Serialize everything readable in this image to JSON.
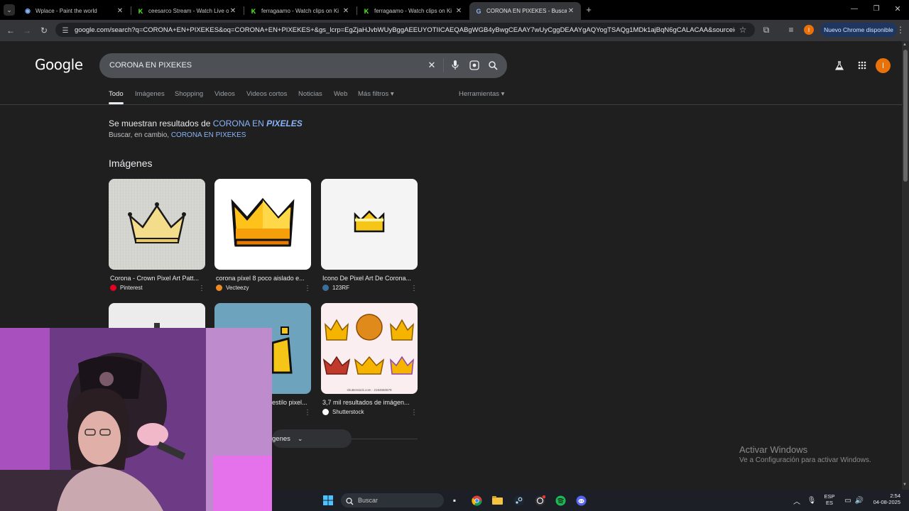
{
  "browser": {
    "tabs": [
      {
        "title": "Wplace - Paint the world",
        "favicon": "globe-icon",
        "color": "#8ab4f8"
      },
      {
        "title": "ceesarco Stream - Watch Live o",
        "favicon": "kick-icon",
        "color": "#53fc18"
      },
      {
        "title": "ferragaamo - Watch clips on Ki",
        "favicon": "kick-icon",
        "color": "#53fc18"
      },
      {
        "title": "ferragaamo - Watch clips on Ki",
        "favicon": "kick-icon",
        "color": "#53fc18"
      },
      {
        "title": "CORONA EN PIXEKES - Buscar c",
        "favicon": "google-icon",
        "color": "#4285f4"
      }
    ],
    "active_tab_index": 4,
    "url": "google.com/search?q=CORONA+EN+PIXEKES&oq=CORONA+EN+PIXEKES+&gs_lcrp=EgZjaHJvbWUyBggAEEUYOTIICAEQABgWGB4yBwgCEAAY7wUyCggDEAAYgAQYogTSAQg1MDk1ajBqN6gCALACAA&sourceid=chrome&i...",
    "update_label": "Nuevo Chrome disponible",
    "profile_initial": "I"
  },
  "google": {
    "logo": "Google",
    "query": "CORONA EN PIXEKES",
    "avatar_initial": "I",
    "nav": [
      {
        "label": "Todo",
        "active": true
      },
      {
        "label": "Imágenes"
      },
      {
        "label": "Shopping"
      },
      {
        "label": "Videos"
      },
      {
        "label": "Videos cortos"
      },
      {
        "label": "Noticias"
      },
      {
        "label": "Web"
      },
      {
        "label": "Más filtros ▾"
      }
    ],
    "tools_label": "Herramientas ▾",
    "spell": {
      "prefix": "Se muestran resultados de ",
      "corrected_a": "CORONA EN ",
      "corrected_b": "PIXELES",
      "instead_prefix": "Buscar, en cambio, ",
      "instead_query": "CORONA EN PIXEKES"
    },
    "images_heading": "Imágenes",
    "images": [
      {
        "caption": "Corona - Crown Pixel Art Patt...",
        "source": "Pinterest",
        "source_color": "#e60023"
      },
      {
        "caption": "corona píxel 8 poco aislado e...",
        "source": "Vecteezy",
        "source_color": "#f08a24"
      },
      {
        "caption": "Icono De Pixel Art De Corona...",
        "source": "123RF",
        "source_color": "#3c6e9a"
      },
      {
        "caption": "",
        "source": "",
        "source_color": "#888888"
      },
      {
        "caption": "estilo pixel...",
        "source": "",
        "source_color": "#888888"
      },
      {
        "caption": "3,7 mil resultados de imágen...",
        "source": "Shutterstock",
        "source_color": "#ffffff"
      }
    ],
    "shutterstock_watermark": "shutterstock.com · 2184560679",
    "more_images_label": "genes"
  },
  "windows": {
    "activate_title": "Activar Windows",
    "activate_sub": "Ve a Configuración para activar Windows.",
    "taskbar_search": "Buscar",
    "lang_top": "ESP",
    "lang_bottom": "ES",
    "time": "2:54",
    "date": "04-08-2025"
  }
}
